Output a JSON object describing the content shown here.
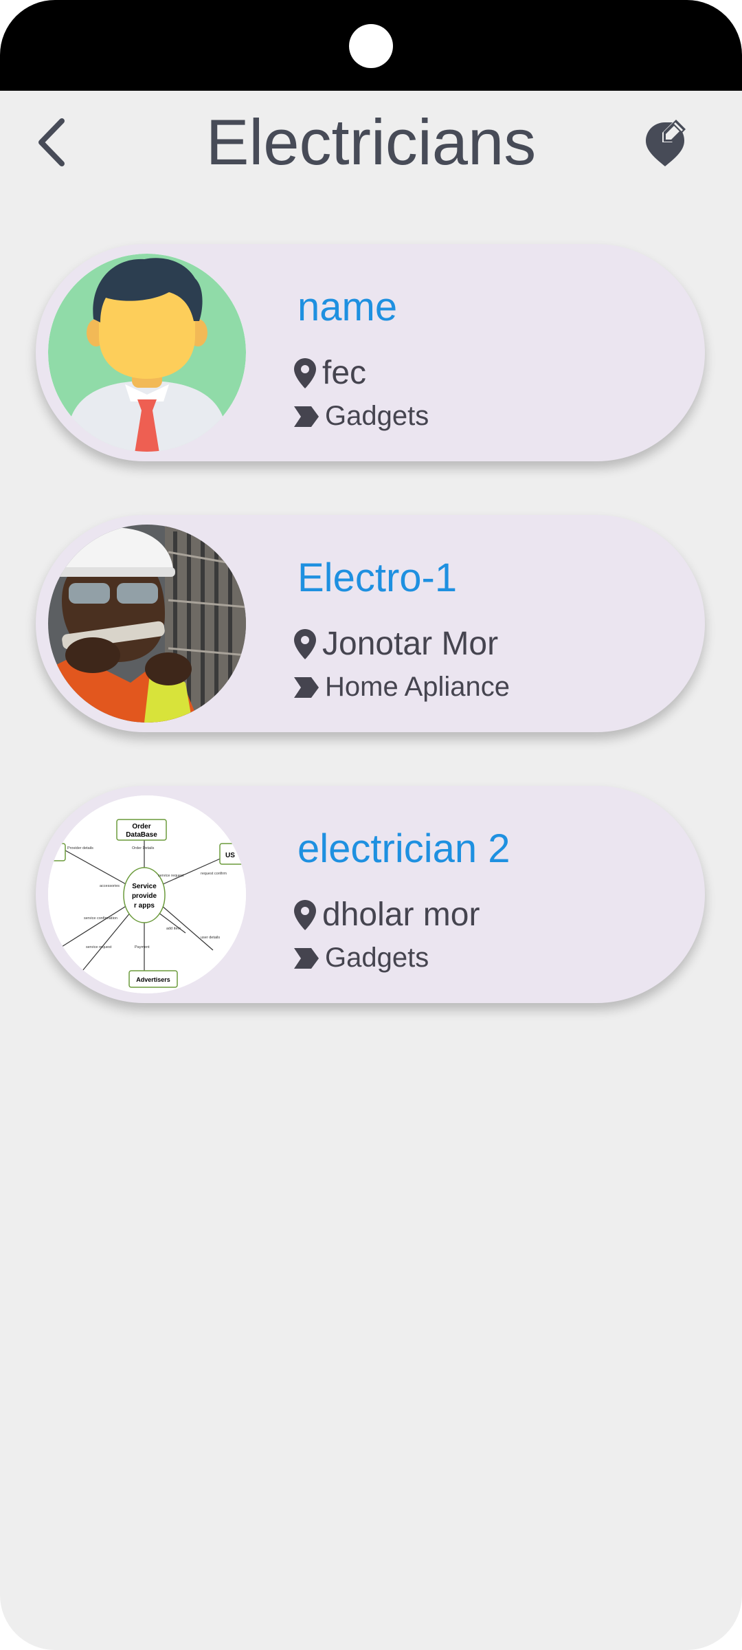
{
  "header": {
    "title": "Electricians",
    "back_icon": "chevron-left-icon",
    "action_icon": "edit-location-icon"
  },
  "colors": {
    "accent": "#1e90e0",
    "card": "#ebe5f0",
    "text": "#45444f",
    "background": "#eeeeee"
  },
  "electricians": [
    {
      "name": "name",
      "location": "fec",
      "category": "Gadgets",
      "avatar": "cartoon-man-avatar"
    },
    {
      "name": "Electro-1",
      "location": "Jonotar Mor",
      "category": "Home Apliance",
      "avatar": "electrician-photo"
    },
    {
      "name": "electrician 2",
      "location": "dholar mor",
      "category": "Gadgets",
      "avatar": "dataflow-diagram-image"
    }
  ],
  "diagram_text": {
    "order_db": [
      "Order",
      "DataBase"
    ],
    "center": [
      "Service",
      "provide",
      "r apps"
    ],
    "advertisers": "Advertisers",
    "us": "US",
    "labels": [
      "Provider details",
      "Order Details",
      "service request",
      "request confirm",
      "accessories",
      "service confirmation",
      "add item",
      "user details",
      "service request",
      "Payment"
    ]
  }
}
